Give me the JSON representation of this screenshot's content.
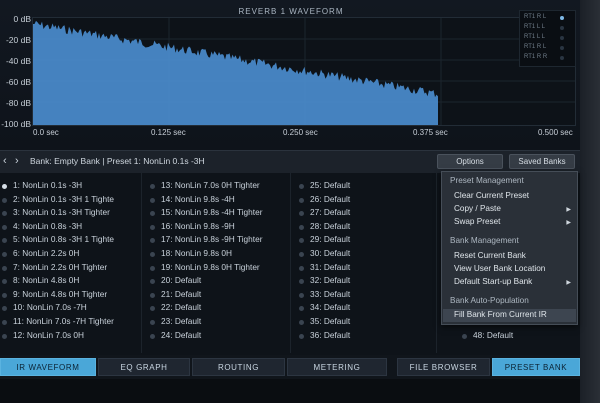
{
  "waveform": {
    "title": "REVERB 1 WAVEFORM",
    "y_labels": [
      "0 dB",
      "-20 dB",
      "-40 dB",
      "-60 dB",
      "-80 dB",
      "-100 dB"
    ],
    "x_labels": [
      "0.0 sec",
      "0.125 sec",
      "0.250 sec",
      "0.375 sec",
      "0.500 sec"
    ],
    "meters": [
      "RT1 R L",
      "RT1 L L",
      "RT1 L L",
      "RT1 R L",
      "RT1 R R"
    ],
    "fill_color": "#4b8fd1"
  },
  "bank_bar": {
    "text": "Bank: Empty Bank | Preset 1: NonLin 0.1s -3H",
    "prev_arrow": "‹",
    "next_arrow": "›",
    "options_label": "Options",
    "saved_banks_label": "Saved Banks"
  },
  "presets": {
    "col1": [
      "1: NonLin 0.1s -3H",
      "2: NonLin 0.1s -3H 1 Tighte",
      "3: NonLin 0.1s -3H Tighter",
      "4: NonLin 0.8s -3H",
      "5: NonLin 0.8s -3H 1 Tighte",
      "6: NonLin 2.2s 0H",
      "7: NonLin 2.2s 0H Tighter",
      "8: NonLin 4.8s 0H",
      "9: NonLin 4.8s 0H Tighter",
      "10: NonLin 7.0s -7H",
      "11: NonLin 7.0s -7H Tighter",
      "12: NonLin 7.0s 0H"
    ],
    "col2": [
      "13: NonLin 7.0s 0H Tighter",
      "14: NonLin 9.8s -4H",
      "15: NonLin 9.8s -4H Tighter",
      "16: NonLin 9.8s -9H",
      "17: NonLin 9.8s -9H Tighter",
      "18: NonLin 9.8s 0H",
      "19: NonLin 9.8s 0H Tighter",
      "20: Default",
      "21: Default",
      "22: Default",
      "23: Default",
      "24: Default"
    ],
    "col3": [
      "25: Default",
      "26: Default",
      "27: Default",
      "28: Default",
      "29: Default",
      "30: Default",
      "31: Default",
      "32: Default",
      "33: Default",
      "34: Default",
      "35: Default",
      "36: Default"
    ],
    "col4_visible": [
      "48: Default"
    ]
  },
  "menu": {
    "heading1": "Preset Management",
    "item1": "Clear Current Preset",
    "item2": "Copy / Paste",
    "item3": "Swap Preset",
    "heading2": "Bank Management",
    "item4": "Reset Current Bank",
    "item5": "View User Bank Location",
    "item6": "Default Start-up Bank",
    "heading3": "Bank Auto-Population",
    "item7": "Fill Bank From Current IR",
    "submenu_arrow": "▶"
  },
  "tabs": {
    "t1": "IR WAVEFORM",
    "t2": "EQ GRAPH",
    "t3": "ROUTING",
    "t4": "METERING",
    "t5": "FILE BROWSER",
    "t6": "PRESET BANK"
  },
  "colors": {
    "accent": "#4aa7d8",
    "waveform": "#4b8fd1"
  }
}
